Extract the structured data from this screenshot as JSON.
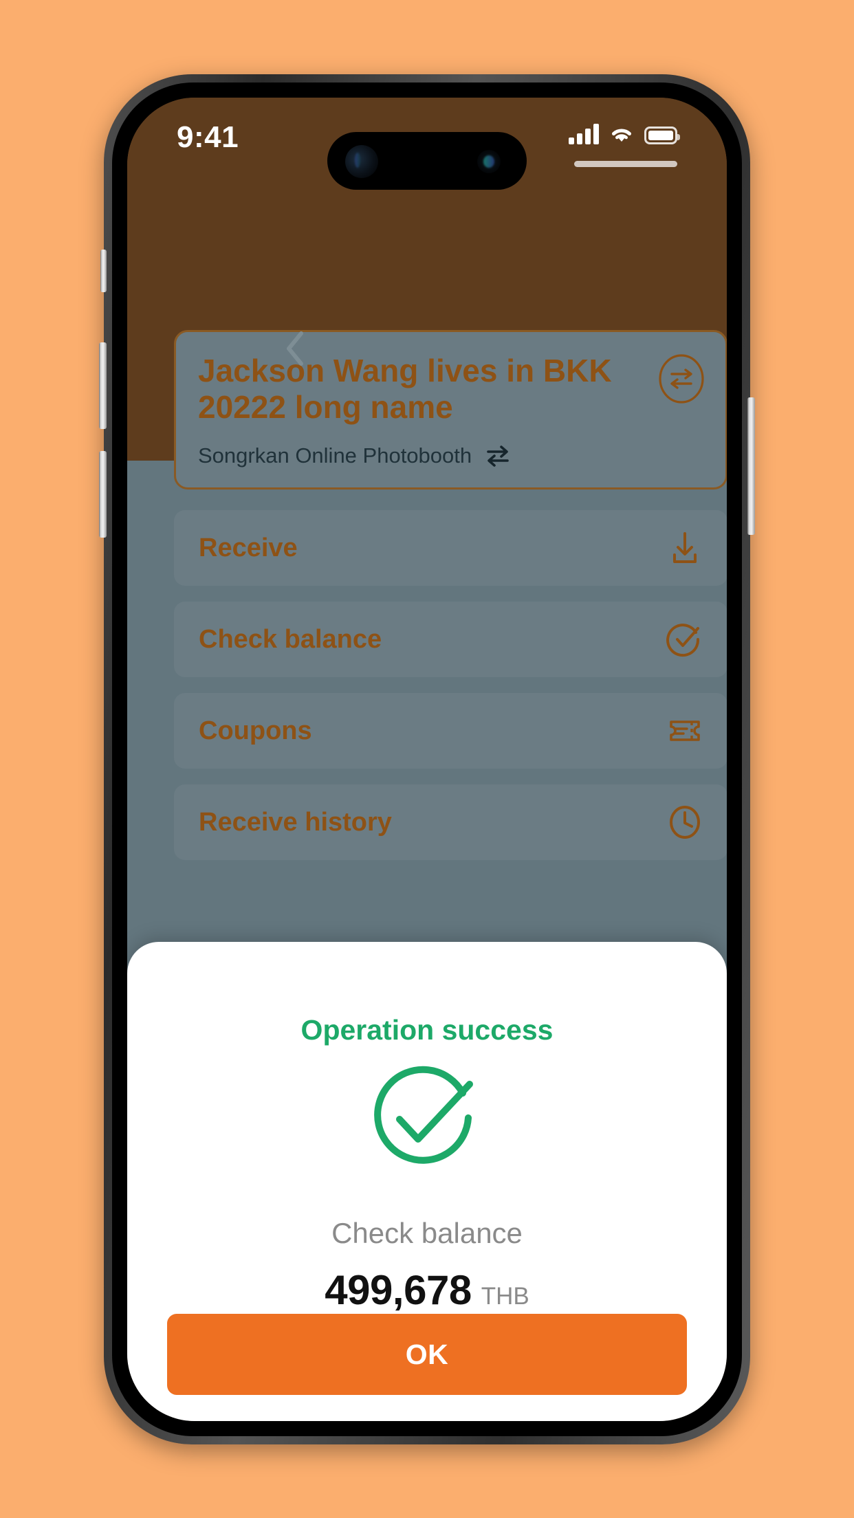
{
  "theme": {
    "page_background": "#FBAE6E",
    "app_background": "#5E3C1D",
    "card_background": "#6A7B83",
    "accent_brown": "#8E5215",
    "accent_orange": "#EE7022",
    "success_green": "#1DA968",
    "overlay": "#63767E"
  },
  "status_bar": {
    "time": "9:41",
    "signal_icon": "cellular-signal-icon",
    "wifi_icon": "wifi-icon",
    "battery_icon": "battery-icon"
  },
  "nav": {
    "back_icon": "chevron-left-icon"
  },
  "profile_card": {
    "name": "Jackson Wang lives in BKK 20222 long name",
    "subtitle": "Songrkan Online Photobooth",
    "swap_circle_icon": "swap-arrows-circle-icon",
    "swap_inline_icon": "swap-arrows-icon"
  },
  "menu": {
    "items": [
      {
        "label": "Receive",
        "icon": "download-icon"
      },
      {
        "label": "Check balance",
        "icon": "check-circle-icon"
      },
      {
        "label": "Coupons",
        "icon": "ticket-icon"
      },
      {
        "label": "Receive history",
        "icon": "clock-icon"
      }
    ]
  },
  "success_sheet": {
    "title": "Operation success",
    "icon": "success-check-circle-icon",
    "caption": "Check balance",
    "amount": "499,678",
    "currency": "THB",
    "confirm_label": "OK"
  }
}
